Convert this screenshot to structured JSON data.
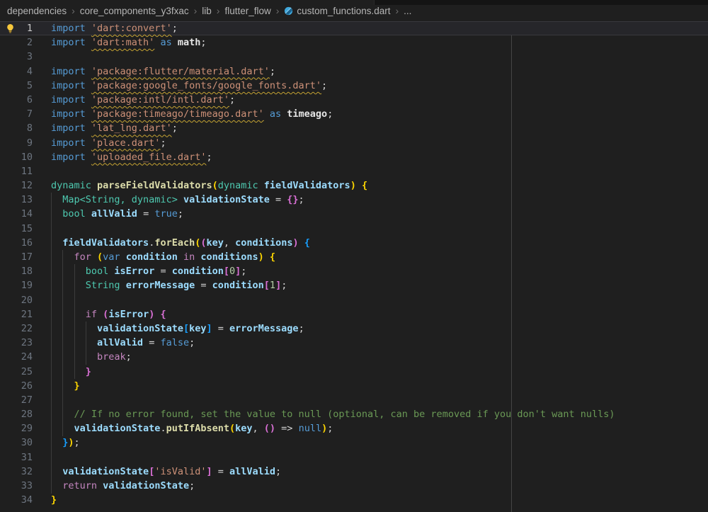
{
  "topbar": {
    "separator": "›",
    "breadcrumb": [
      {
        "label": "dependencies"
      },
      {
        "label": "core_components_y3fxac"
      },
      {
        "label": "lib"
      },
      {
        "label": "flutter_flow"
      },
      {
        "label": "custom_functions.dart"
      }
    ],
    "trailing_ellipsis": "...",
    "file_icon_color": "#3FA7DC"
  },
  "editor": {
    "background": "#1f1f1f",
    "ruler_column": 80,
    "current_line": 1,
    "lightbulb_color": "#F6C73C",
    "squiggle_color": "#C5A332",
    "palette": {
      "kw": {
        "color": "#569CD6"
      },
      "ctl": {
        "color": "#C586C0"
      },
      "type": {
        "color": "#4EC9B0"
      },
      "fn": {
        "color": "#DCDCAA",
        "bold": true
      },
      "var": {
        "color": "#9CDCFE",
        "bold": true
      },
      "al": {
        "color": "#E6E6E6",
        "bold": true
      },
      "str": {
        "color": "#CE9178"
      },
      "strsq": {
        "color": "#CE9178",
        "squiggle": true
      },
      "num": {
        "color": "#B5CEA8"
      },
      "cmt": {
        "color": "#6A9955"
      },
      "pun": {
        "color": "#D4D4D4"
      },
      "b1": {
        "color": "#FFD700",
        "bold": true
      },
      "b2": {
        "color": "#DA70D6",
        "bold": true
      },
      "b3": {
        "color": "#179FFF",
        "bold": true
      }
    },
    "indent_guides": [
      {
        "col": 0,
        "from": 13,
        "to": 33
      },
      {
        "col": 2,
        "from": 17,
        "to": 29
      },
      {
        "col": 4,
        "from": 18,
        "to": 25
      },
      {
        "col": 6,
        "from": 22,
        "to": 24
      }
    ],
    "lines": [
      {
        "n": "1",
        "t": [
          [
            "kw",
            "import "
          ],
          [
            "strsq",
            "'dart:convert'"
          ],
          [
            "pun",
            ";"
          ]
        ]
      },
      {
        "n": "2",
        "t": [
          [
            "kw",
            "import "
          ],
          [
            "strsq",
            "'dart:math'"
          ],
          [
            "pun",
            " "
          ],
          [
            "kw",
            "as "
          ],
          [
            "al",
            "math"
          ],
          [
            "pun",
            ";"
          ]
        ]
      },
      {
        "n": "3",
        "t": []
      },
      {
        "n": "4",
        "t": [
          [
            "kw",
            "import "
          ],
          [
            "strsq",
            "'package:flutter/material.dart'"
          ],
          [
            "pun",
            ";"
          ]
        ]
      },
      {
        "n": "5",
        "t": [
          [
            "kw",
            "import "
          ],
          [
            "strsq",
            "'package:google_fonts/google_fonts.dart'"
          ],
          [
            "pun",
            ";"
          ]
        ]
      },
      {
        "n": "6",
        "t": [
          [
            "kw",
            "import "
          ],
          [
            "strsq",
            "'package:intl/intl.dart'"
          ],
          [
            "pun",
            ";"
          ]
        ]
      },
      {
        "n": "7",
        "t": [
          [
            "kw",
            "import "
          ],
          [
            "strsq",
            "'package:timeago/timeago.dart'"
          ],
          [
            "pun",
            " "
          ],
          [
            "kw",
            "as "
          ],
          [
            "al",
            "timeago"
          ],
          [
            "pun",
            ";"
          ]
        ]
      },
      {
        "n": "8",
        "t": [
          [
            "kw",
            "import "
          ],
          [
            "strsq",
            "'lat_lng.dart'"
          ],
          [
            "pun",
            ";"
          ]
        ]
      },
      {
        "n": "9",
        "t": [
          [
            "kw",
            "import "
          ],
          [
            "strsq",
            "'place.dart'"
          ],
          [
            "pun",
            ";"
          ]
        ]
      },
      {
        "n": "10",
        "t": [
          [
            "kw",
            "import "
          ],
          [
            "strsq",
            "'uploaded_file.dart'"
          ],
          [
            "pun",
            ";"
          ]
        ]
      },
      {
        "n": "11",
        "t": []
      },
      {
        "n": "12",
        "t": [
          [
            "type",
            "dynamic "
          ],
          [
            "fn",
            "parseFieldValidators"
          ],
          [
            "b1",
            "("
          ],
          [
            "type",
            "dynamic "
          ],
          [
            "var",
            "fieldValidators"
          ],
          [
            "b1",
            ")"
          ],
          [
            "pun",
            " "
          ],
          [
            "b1",
            "{"
          ]
        ]
      },
      {
        "n": "13",
        "t": [
          [
            "pun",
            "  "
          ],
          [
            "type",
            "Map<String, dynamic> "
          ],
          [
            "var",
            "validationState"
          ],
          [
            "pun",
            " = "
          ],
          [
            "b2",
            "{}"
          ],
          [
            "pun",
            ";"
          ]
        ]
      },
      {
        "n": "14",
        "t": [
          [
            "pun",
            "  "
          ],
          [
            "type",
            "bool "
          ],
          [
            "var",
            "allValid"
          ],
          [
            "pun",
            " = "
          ],
          [
            "kw",
            "true"
          ],
          [
            "pun",
            ";"
          ]
        ]
      },
      {
        "n": "15",
        "t": []
      },
      {
        "n": "16",
        "t": [
          [
            "pun",
            "  "
          ],
          [
            "var",
            "fieldValidators"
          ],
          [
            "pun",
            "."
          ],
          [
            "fn",
            "forEach"
          ],
          [
            "b1",
            "("
          ],
          [
            "b2",
            "("
          ],
          [
            "var",
            "key"
          ],
          [
            "pun",
            ", "
          ],
          [
            "var",
            "conditions"
          ],
          [
            "b2",
            ")"
          ],
          [
            "pun",
            " "
          ],
          [
            "b3",
            "{"
          ]
        ]
      },
      {
        "n": "17",
        "t": [
          [
            "pun",
            "    "
          ],
          [
            "ctl",
            "for "
          ],
          [
            "b1",
            "("
          ],
          [
            "kw",
            "var "
          ],
          [
            "var",
            "condition"
          ],
          [
            "ctl",
            " in "
          ],
          [
            "var",
            "conditions"
          ],
          [
            "b1",
            ")"
          ],
          [
            "pun",
            " "
          ],
          [
            "b1",
            "{"
          ]
        ]
      },
      {
        "n": "18",
        "t": [
          [
            "pun",
            "      "
          ],
          [
            "type",
            "bool "
          ],
          [
            "var",
            "isError"
          ],
          [
            "pun",
            " = "
          ],
          [
            "var",
            "condition"
          ],
          [
            "b2",
            "["
          ],
          [
            "num",
            "0"
          ],
          [
            "b2",
            "]"
          ],
          [
            "pun",
            ";"
          ]
        ]
      },
      {
        "n": "19",
        "t": [
          [
            "pun",
            "      "
          ],
          [
            "type",
            "String "
          ],
          [
            "var",
            "errorMessage"
          ],
          [
            "pun",
            " = "
          ],
          [
            "var",
            "condition"
          ],
          [
            "b2",
            "["
          ],
          [
            "num",
            "1"
          ],
          [
            "b2",
            "]"
          ],
          [
            "pun",
            ";"
          ]
        ]
      },
      {
        "n": "20",
        "t": []
      },
      {
        "n": "21",
        "t": [
          [
            "pun",
            "      "
          ],
          [
            "ctl",
            "if "
          ],
          [
            "b2",
            "("
          ],
          [
            "var",
            "isError"
          ],
          [
            "b2",
            ")"
          ],
          [
            "pun",
            " "
          ],
          [
            "b2",
            "{"
          ]
        ]
      },
      {
        "n": "22",
        "t": [
          [
            "pun",
            "        "
          ],
          [
            "var",
            "validationState"
          ],
          [
            "b3",
            "["
          ],
          [
            "var",
            "key"
          ],
          [
            "b3",
            "]"
          ],
          [
            "pun",
            " = "
          ],
          [
            "var",
            "errorMessage"
          ],
          [
            "pun",
            ";"
          ]
        ]
      },
      {
        "n": "23",
        "t": [
          [
            "pun",
            "        "
          ],
          [
            "var",
            "allValid"
          ],
          [
            "pun",
            " = "
          ],
          [
            "kw",
            "false"
          ],
          [
            "pun",
            ";"
          ]
        ]
      },
      {
        "n": "24",
        "t": [
          [
            "pun",
            "        "
          ],
          [
            "ctl",
            "break"
          ],
          [
            "pun",
            ";"
          ]
        ]
      },
      {
        "n": "25",
        "t": [
          [
            "pun",
            "      "
          ],
          [
            "b2",
            "}"
          ]
        ]
      },
      {
        "n": "26",
        "t": [
          [
            "pun",
            "    "
          ],
          [
            "b1",
            "}"
          ]
        ]
      },
      {
        "n": "27",
        "t": []
      },
      {
        "n": "28",
        "t": [
          [
            "pun",
            "    "
          ],
          [
            "cmt",
            "// If no error found, set the value to null (optional, can be removed if you don't want nulls)"
          ]
        ]
      },
      {
        "n": "29",
        "t": [
          [
            "pun",
            "    "
          ],
          [
            "var",
            "validationState"
          ],
          [
            "pun",
            "."
          ],
          [
            "fn",
            "putIfAbsent"
          ],
          [
            "b1",
            "("
          ],
          [
            "var",
            "key"
          ],
          [
            "pun",
            ", "
          ],
          [
            "b2",
            "()"
          ],
          [
            "pun",
            " => "
          ],
          [
            "kw",
            "null"
          ],
          [
            "b1",
            ")"
          ],
          [
            "pun",
            ";"
          ]
        ]
      },
      {
        "n": "30",
        "t": [
          [
            "pun",
            "  "
          ],
          [
            "b3",
            "}"
          ],
          [
            "b1",
            ")"
          ],
          [
            "pun",
            ";"
          ]
        ]
      },
      {
        "n": "31",
        "t": []
      },
      {
        "n": "32",
        "t": [
          [
            "pun",
            "  "
          ],
          [
            "var",
            "validationState"
          ],
          [
            "b2",
            "["
          ],
          [
            "str",
            "'isValid'"
          ],
          [
            "b2",
            "]"
          ],
          [
            "pun",
            " = "
          ],
          [
            "var",
            "allValid"
          ],
          [
            "pun",
            ";"
          ]
        ]
      },
      {
        "n": "33",
        "t": [
          [
            "pun",
            "  "
          ],
          [
            "ctl",
            "return "
          ],
          [
            "var",
            "validationState"
          ],
          [
            "pun",
            ";"
          ]
        ]
      },
      {
        "n": "34",
        "t": [
          [
            "b1",
            "}"
          ]
        ]
      }
    ]
  }
}
